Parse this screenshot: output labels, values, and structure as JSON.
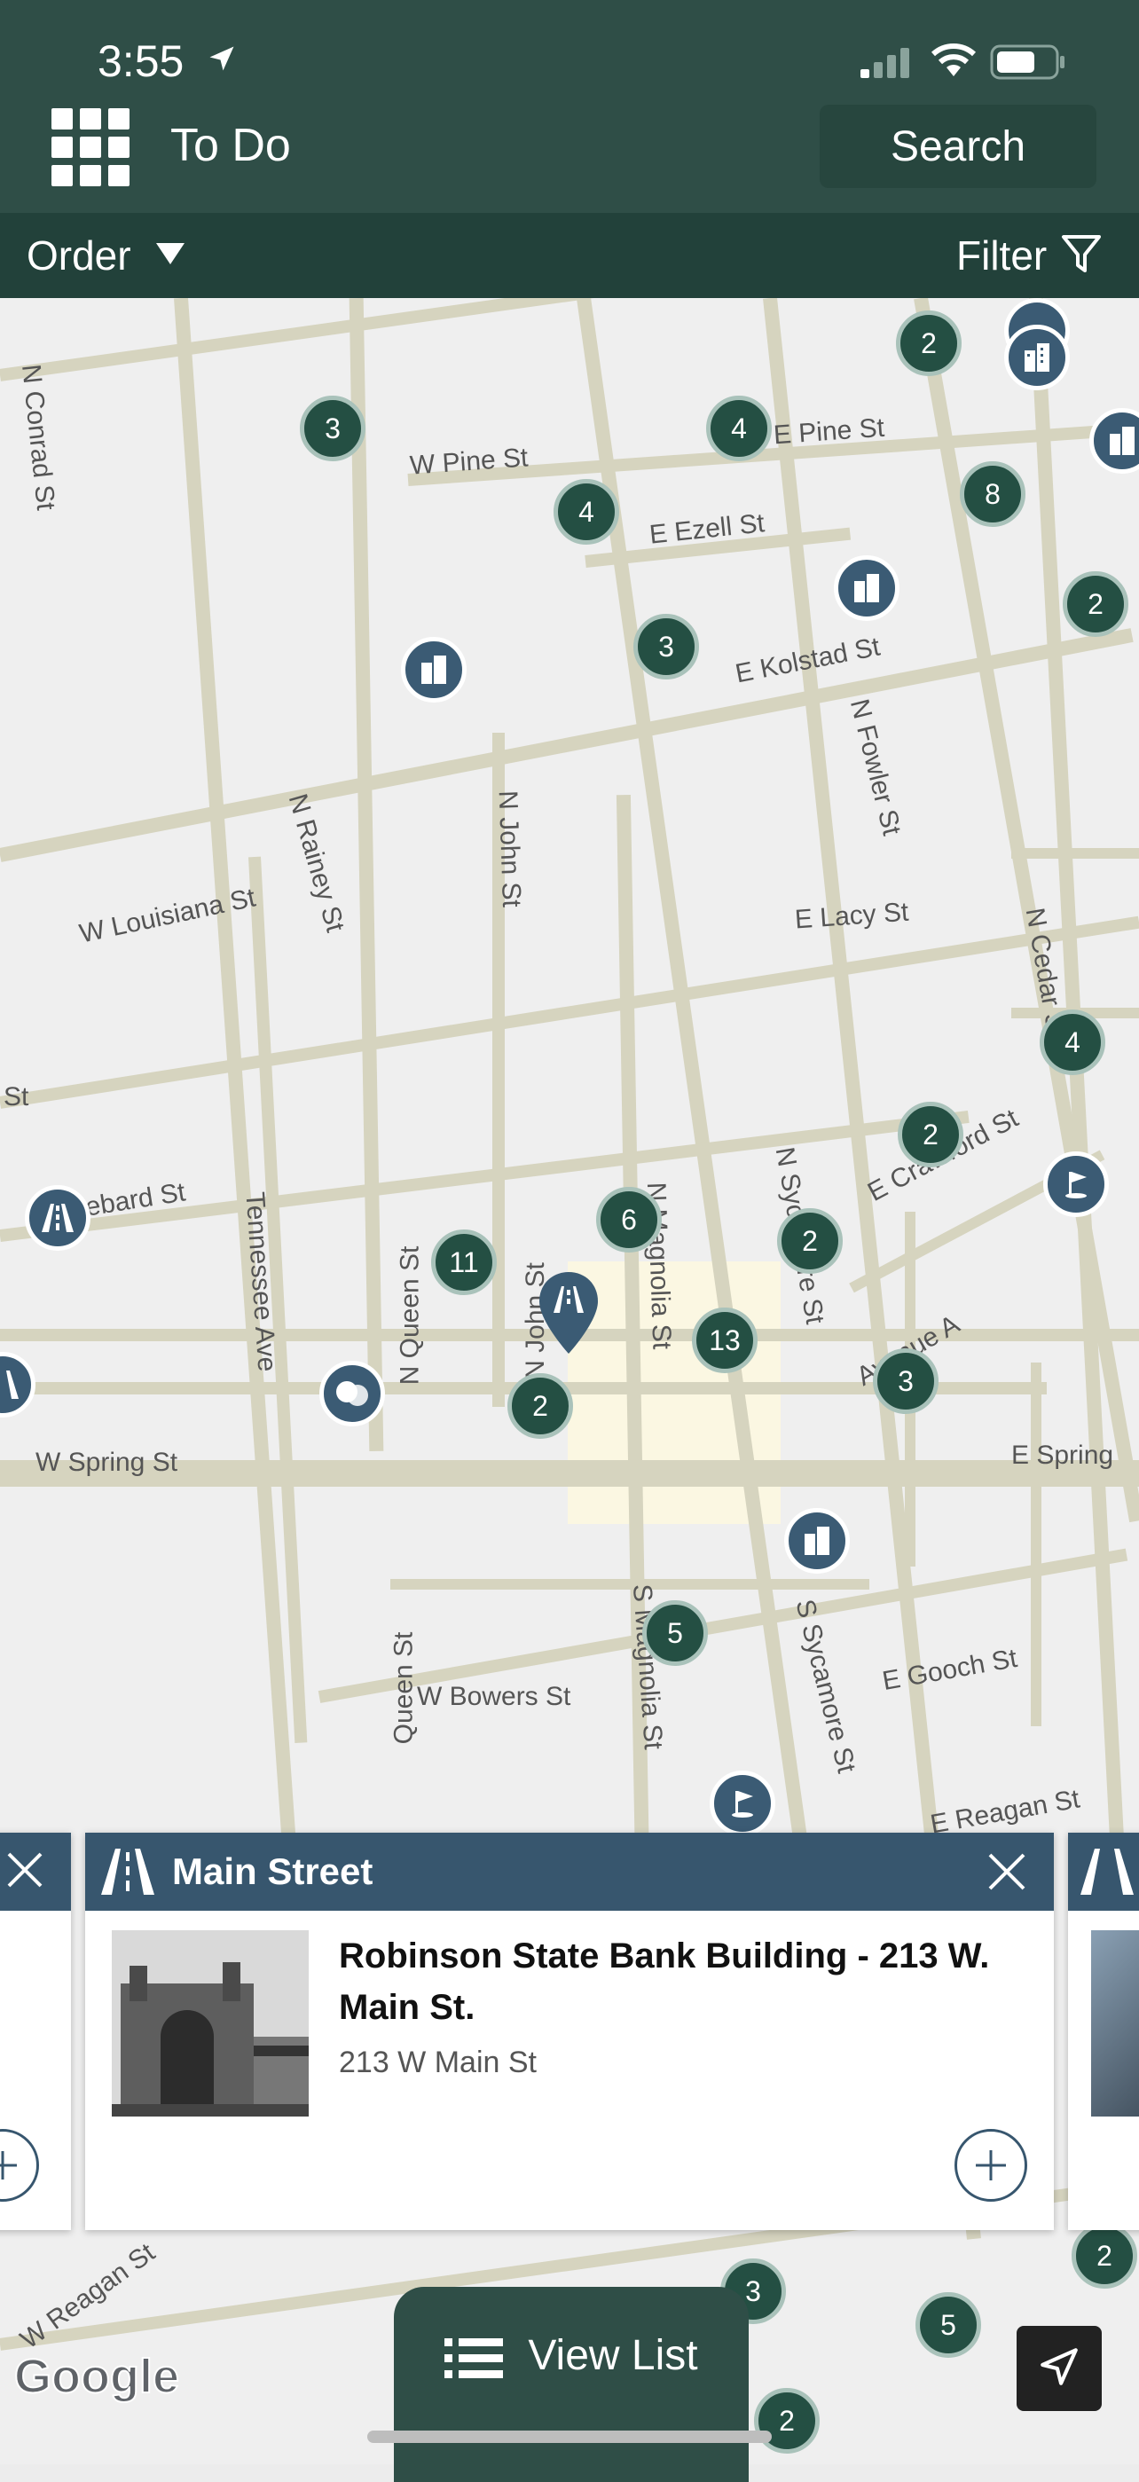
{
  "status": {
    "time": "3:55"
  },
  "header": {
    "title": "To Do",
    "search_label": "Search"
  },
  "toolbar": {
    "order_label": "Order",
    "filter_label": "Filter"
  },
  "map": {
    "streets": {
      "n_conrad": "N Conrad St",
      "w_pine": "W Pine St",
      "e_pine": "E Pine St",
      "e_ezell": "E Ezell St",
      "e_kolstad": "E Kolstad St",
      "n_fowler": "N Fowler St",
      "n_rainey": "N Rainey St",
      "n_john": "N John St",
      "w_louisiana": "W Louisiana St",
      "e_lacy": "E Lacy St",
      "n_cedar": "N Cedar St",
      "st_left": "St",
      "hebard": "ebard St",
      "tennessee": "Tennessee Ave",
      "n_queen": "N Queen St",
      "n_john2": "N John St",
      "n_magnolia": "N Magnolia St",
      "n_sycamore": "N Sycamore St",
      "e_crawford": "E Crawford St",
      "avenue_a": "Avenue A",
      "w_spring": "W Spring St",
      "e_spring": "E Spring",
      "queen_st": "Queen St",
      "w_bowers": "W Bowers St",
      "s_magnolia": "S Magnolia St",
      "s_sycamore": "S Sycamore St",
      "e_gooch": "E Gooch St",
      "e_reagan": "E Reagan St",
      "w_reagan": "W Reagan St"
    },
    "clusters": [
      "2",
      "3",
      "4",
      "4",
      "8",
      "2",
      "3",
      "4",
      "2",
      "6",
      "11",
      "2",
      "13",
      "2",
      "3",
      "5",
      "3",
      "5",
      "2",
      "2"
    ],
    "google_logo": "Google"
  },
  "card": {
    "category": "Main Street",
    "title": "Robinson State Bank Building - 213 W. Main St.",
    "address": "213 W Main St"
  },
  "bottom": {
    "view_list_label": "View List"
  },
  "colors": {
    "header": "#2f4e47",
    "subheader": "#22413a",
    "cluster": "#244f43",
    "poi": "#3b5b74",
    "card_header": "#37566e"
  }
}
